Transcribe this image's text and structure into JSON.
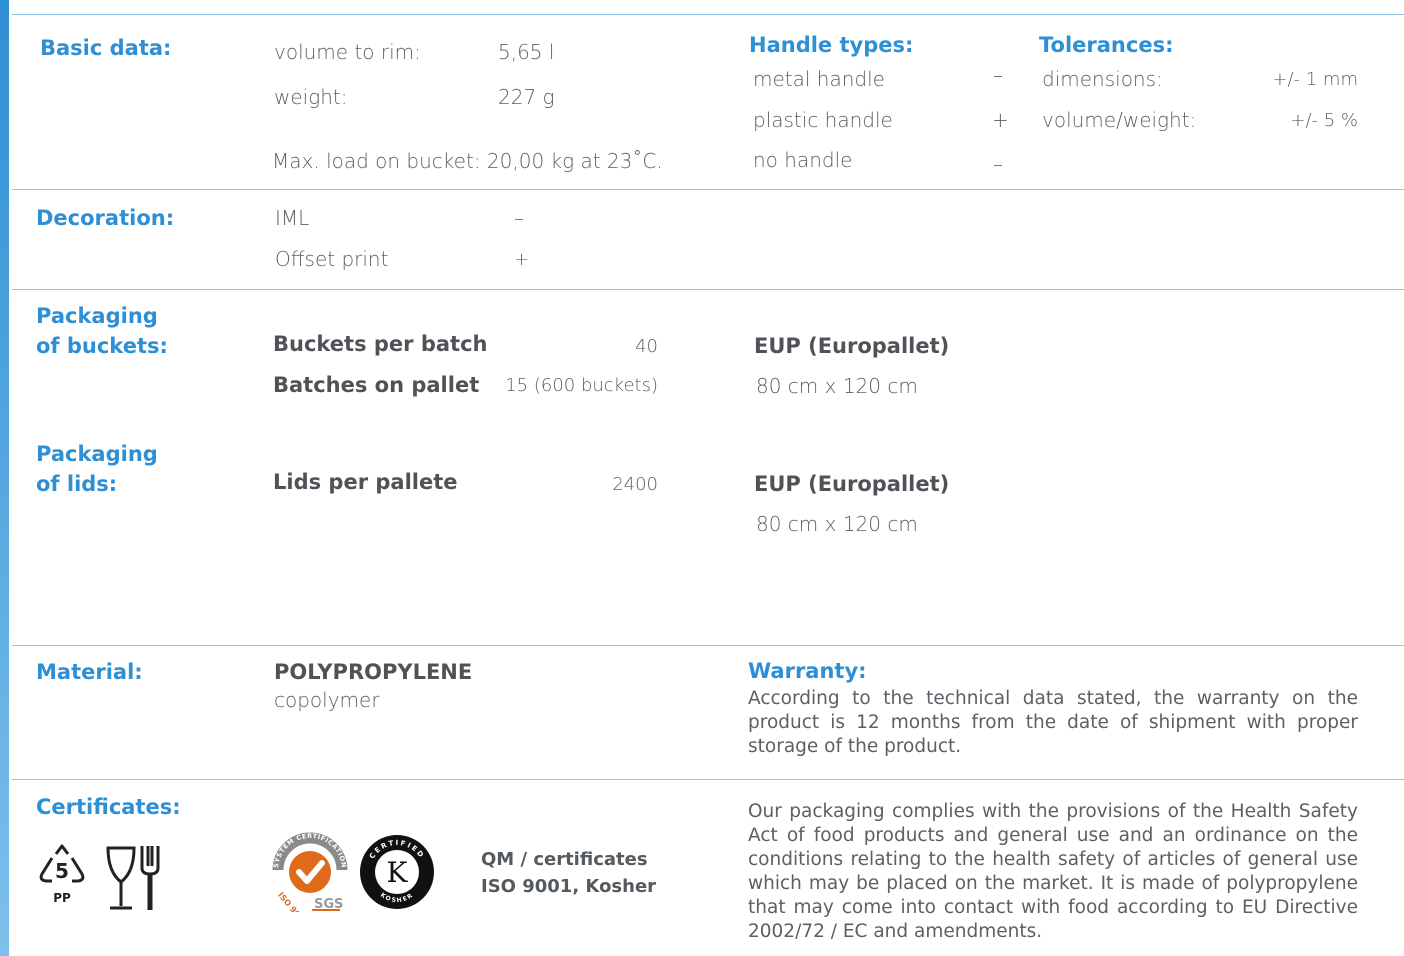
{
  "basic": {
    "heading": "Basic data:",
    "volume_label": "volume to rim:",
    "volume_value": "5,65 l",
    "weight_label": "weight:",
    "weight_value": "227 g",
    "max_load": "Max. load on bucket: 20,00 kg at 23˚C."
  },
  "handles": {
    "heading": "Handle types:",
    "items": [
      {
        "label": "metal handle",
        "mark": "–"
      },
      {
        "label": "plastic handle",
        "mark": "+"
      },
      {
        "label": "no handle",
        "mark": "–"
      }
    ]
  },
  "tolerances": {
    "heading": "Tolerances:",
    "items": [
      {
        "label": "dimensions:",
        "value": "+/- 1 mm"
      },
      {
        "label": "volume/weight:",
        "value": "+/- 5 %"
      }
    ]
  },
  "decoration": {
    "heading": "Decoration:",
    "items": [
      {
        "label": "IML",
        "mark": "–"
      },
      {
        "label": "Offset print",
        "mark": "+"
      }
    ]
  },
  "packaging_buckets": {
    "heading_line1": "Packaging",
    "heading_line2": "of buckets:",
    "per_batch_label": "Buckets per batch",
    "per_batch_value": "40",
    "on_pallet_label": "Batches on pallet",
    "on_pallet_value": "15 (600 buckets)",
    "pallet_title": "EUP (Europallet)",
    "pallet_size": "80 cm x 120 cm"
  },
  "packaging_lids": {
    "heading_line1": "Packaging",
    "heading_line2": "of lids:",
    "per_pallet_label": "Lids per pallete",
    "per_pallet_value": "2400",
    "pallet_title": "EUP (Europallet)",
    "pallet_size": "80 cm x 120 cm"
  },
  "material": {
    "heading": "Material:",
    "name": "POLYPROPYLENE",
    "type": "copolymer"
  },
  "warranty": {
    "heading": "Warranty:",
    "text": "According to the technical data stated, the warranty on the product is 12 months from the date of shipment with proper storage of the product."
  },
  "certificates": {
    "heading": "Certificates:",
    "recycle_number": "5",
    "recycle_code": "PP",
    "iso_seal_top": "SYSTEM CERTIFICATION",
    "iso_seal_bottom": "ISO 9001",
    "sgs": "SGS",
    "kosher_top": "CERTIFIED",
    "kosher_bottom": "KOSHER",
    "kosher_letter": "K",
    "qm_line1": "QM / certificates",
    "qm_line2": "ISO 9001, Kosher",
    "compliance_text": "Our packaging complies with the provisions of the Health Safety Act of food products and general use and an ordinance on the conditions relating to the health safety of articles of general use which may be placed on the market. It is made of polypropylene that may come into contact with food according to EU Directive 2002/72 / EC and amendments."
  },
  "colors": {
    "accent": "#2e8fd5",
    "rule": "#8fc6e8",
    "text": "#5b6066",
    "iso_orange": "#e06a1c"
  }
}
